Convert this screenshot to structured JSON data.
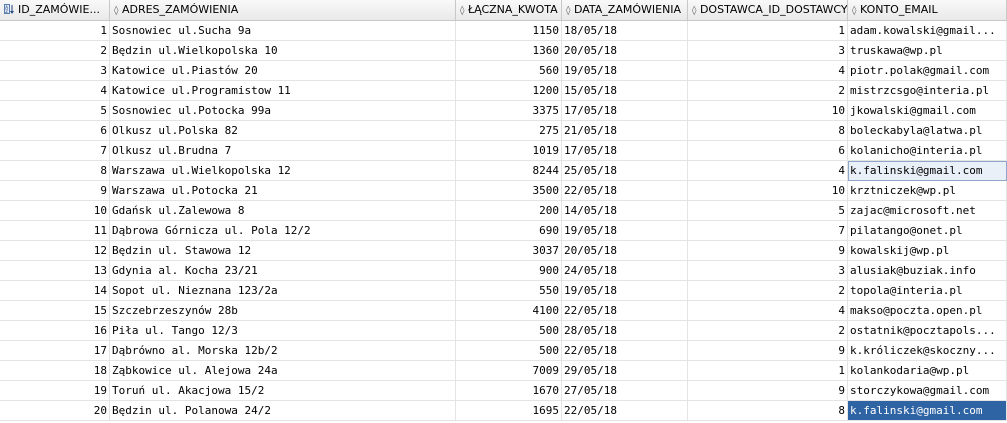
{
  "columns": [
    {
      "label": "ID_ZAMÓWIE..."
    },
    {
      "label": "ADRES_ZAMÓWIENIA"
    },
    {
      "label": "ŁĄCZNA_KWOTA"
    },
    {
      "label": "DATA_ZAMÓWIENIA"
    },
    {
      "label": "DOSTAWCA_ID_DOSTAWCY"
    },
    {
      "label": "KONTO_EMAIL"
    }
  ],
  "rows": [
    {
      "id": "1",
      "adres": "Sosnowiec ul.Sucha 9a",
      "kwota": "1150",
      "data": "18/05/18",
      "dostawca": "1",
      "email": "adam.kowalski@gmail..."
    },
    {
      "id": "2",
      "adres": "Będzin ul.Wielkopolska 10",
      "kwota": "1360",
      "data": "20/05/18",
      "dostawca": "3",
      "email": "truskawa@wp.pl"
    },
    {
      "id": "3",
      "adres": "Katowice ul.Piastów 20",
      "kwota": "560",
      "data": "19/05/18",
      "dostawca": "4",
      "email": "piotr.polak@gmail.com"
    },
    {
      "id": "4",
      "adres": "Katowice ul.Programistow 11",
      "kwota": "1200",
      "data": "15/05/18",
      "dostawca": "2",
      "email": "mistrzcsgo@interia.pl"
    },
    {
      "id": "5",
      "adres": "Sosnowiec ul.Potocka 99a",
      "kwota": "3375",
      "data": "17/05/18",
      "dostawca": "10",
      "email": "jkowalski@gmail.com"
    },
    {
      "id": "6",
      "adres": "Olkusz ul.Polska 82",
      "kwota": "275",
      "data": "21/05/18",
      "dostawca": "8",
      "email": "boleckabyla@latwa.pl"
    },
    {
      "id": "7",
      "adres": "Olkusz ul.Brudna 7",
      "kwota": "1019",
      "data": "17/05/18",
      "dostawca": "6",
      "email": "kolanicho@interia.pl"
    },
    {
      "id": "8",
      "adres": "Warszawa ul.Wielkopolska 12",
      "kwota": "8244",
      "data": "25/05/18",
      "dostawca": "4",
      "email": "k.falinski@gmail.com"
    },
    {
      "id": "9",
      "adres": "Warszawa ul.Potocka 21",
      "kwota": "3500",
      "data": "22/05/18",
      "dostawca": "10",
      "email": "krztniczek@wp.pl"
    },
    {
      "id": "10",
      "adres": "Gdańsk ul.Zalewowa 8",
      "kwota": "200",
      "data": "14/05/18",
      "dostawca": "5",
      "email": "zajac@microsoft.net"
    },
    {
      "id": "11",
      "adres": "Dąbrowa Górnicza ul. Pola 12/2",
      "kwota": "690",
      "data": "19/05/18",
      "dostawca": "7",
      "email": "pilatango@onet.pl"
    },
    {
      "id": "12",
      "adres": "Będzin ul. Stawowa 12",
      "kwota": "3037",
      "data": "20/05/18",
      "dostawca": "9",
      "email": "kowalskij@wp.pl"
    },
    {
      "id": "13",
      "adres": "Gdynia al. Kocha 23/21",
      "kwota": "900",
      "data": "24/05/18",
      "dostawca": "3",
      "email": "alusiak@buziak.info"
    },
    {
      "id": "14",
      "adres": "Sopot ul. Nieznana 123/2a",
      "kwota": "550",
      "data": "19/05/18",
      "dostawca": "2",
      "email": "topola@interia.pl"
    },
    {
      "id": "15",
      "adres": "Szczebrzeszynów 28b",
      "kwota": "4100",
      "data": "22/05/18",
      "dostawca": "4",
      "email": "makso@poczta.open.pl"
    },
    {
      "id": "16",
      "adres": "Piła ul. Tango 12/3",
      "kwota": "500",
      "data": "28/05/18",
      "dostawca": "2",
      "email": "ostatnik@pocztapols..."
    },
    {
      "id": "17",
      "adres": "Dąbrówno al. Morska 12b/2",
      "kwota": "500",
      "data": "22/05/18",
      "dostawca": "9",
      "email": "k.króliczek@skoczny..."
    },
    {
      "id": "18",
      "adres": "Ząbkowice ul. Alejowa 24a",
      "kwota": "7009",
      "data": "29/05/18",
      "dostawca": "1",
      "email": "kolankodaria@wp.pl"
    },
    {
      "id": "19",
      "adres": "Toruń ul. Akacjowa 15/2",
      "kwota": "1670",
      "data": "27/05/18",
      "dostawca": "9",
      "email": "storczykowa@gmail.com"
    },
    {
      "id": "20",
      "adres": "Będzin ul. Polanowa 24/2",
      "kwota": "1695",
      "data": "22/05/18",
      "dostawca": "8",
      "email": "k.falinski@gmail.com"
    }
  ],
  "header_icon": "sort-ascending-icon",
  "selection": {
    "focused_row": 8,
    "selected_row": 20,
    "column": "KONTO_EMAIL"
  }
}
